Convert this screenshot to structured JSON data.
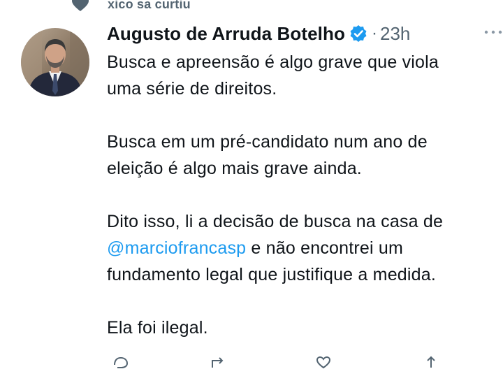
{
  "social_context": {
    "text": "xico sa curtiu",
    "icon": "like-icon"
  },
  "author": {
    "name": "Augusto de Arruda Botelho",
    "verified_icon": "verified-badge-icon",
    "avatar_icon": "profile-photo",
    "timestamp": "23h",
    "separator": "·"
  },
  "tweet": {
    "paragraphs": [
      {
        "lines": [
          {
            "text": "Busca e apreensão é algo grave que viola"
          },
          {
            "text": "uma série de direitos."
          }
        ]
      },
      {
        "lines": [
          {
            "text": "Busca em um pré-candidato num ano de"
          },
          {
            "text": "eleição é algo mais grave ainda."
          }
        ]
      },
      {
        "lines": [
          {
            "text": "Dito isso, li a decisão de busca na casa de"
          },
          {
            "mention": "@marciofrancasp",
            "text": " e não encontrei um"
          },
          {
            "text": "fundamento legal que justifique a medida."
          }
        ]
      },
      {
        "lines": [
          {
            "text": "Ela foi ilegal."
          }
        ]
      }
    ]
  },
  "colors": {
    "text": "#0f1419",
    "secondary": "#536471",
    "accent": "#1d9bf0"
  },
  "actions": {
    "icons": [
      "reply-icon",
      "retweet-icon",
      "like-icon",
      "share-icon"
    ]
  }
}
